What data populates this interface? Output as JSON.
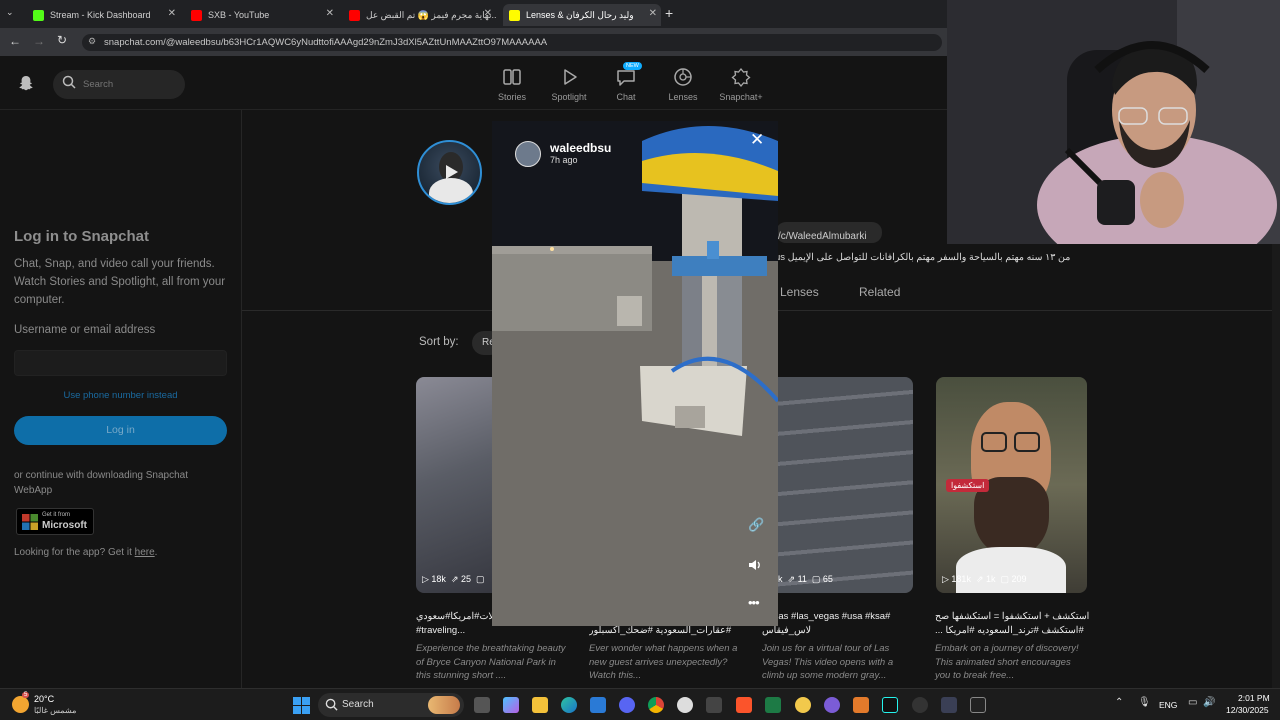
{
  "browser": {
    "tabs": [
      {
        "label": "Stream - Kick Dashboard",
        "icon": "kick-icon",
        "color": "#53fc18"
      },
      {
        "label": "SXB - YouTube",
        "icon": "youtube-icon",
        "color": "#ff0000"
      },
      {
        "label": "نهاية مجرم فيمز 😱 تم القبض عل...",
        "icon": "youtube-icon",
        "color": "#ff0000"
      },
      {
        "label": "وليد رحال الكرفان & Lenses",
        "icon": "snapchat-icon",
        "color": "#fffc00",
        "active": true
      }
    ],
    "new_tab_label": "+",
    "url": "snapchat.com/@waleedbsu/b63HCr1AQWC6yNudttofiAAAgd29nZmJ3dXl5AZttUnMAAZttO97MAAAAAA"
  },
  "snapchat": {
    "search_placeholder": "Search",
    "nav": [
      {
        "label": "Stories",
        "icon": "stories-icon"
      },
      {
        "label": "Spotlight",
        "icon": "spotlight-icon"
      },
      {
        "label": "Chat",
        "icon": "chat-icon",
        "badge": "NEW"
      },
      {
        "label": "Lenses",
        "icon": "lenses-icon"
      },
      {
        "label": "Snapchat+",
        "icon": "snapchat-plus-icon"
      }
    ],
    "login": {
      "title": "Log in to Snapchat",
      "subtitle": "Chat, Snap, and video call your friends. Watch Stories and Spotlight, all from your computer.",
      "username_label": "Username or email address",
      "username_value": "",
      "phone_link": "Use phone number instead",
      "login_button": "Log in",
      "webapp_text": "or continue with downloading Snapchat WebApp",
      "store_small": "Get it from",
      "store_big": "Microsoft",
      "app_text": "Looking for the app? Get it",
      "app_link": "here",
      "app_end": "."
    },
    "profile": {
      "link": "/c/WaleedAlmubarki",
      "bio": "من ١٣ سنه مهتم بالسياحة والسفر مهتم بالكرافانات للتواصل على الإيميل us",
      "tabs": [
        "Lenses",
        "Related"
      ]
    },
    "sort_label": "Sort by:",
    "sort_value": "Re",
    "cards": [
      {
        "views": "18k",
        "shares": "25",
        "comments": "",
        "title": "سبحان الخالق #رحلات#امريكا#سعودي #traveling...",
        "desc": "Experience the breathtaking beauty of Bryce Canyon National Park in this stunning short ...."
      },
      {
        "views": "",
        "shares": "",
        "comments": "",
        "title": "#عقارات_السعودية #ضحك_اكسبلور",
        "desc": "Ever wonder what happens when a new guest arrives unexpectedly? Watch this..."
      },
      {
        "views": "31k",
        "shares": "11",
        "comments": "65",
        "title": "Vegas #las_vegas #usa #ksa# لاس_فيقاس",
        "desc": "Join us for a virtual tour of Las Vegas! This video opens with a climb up some modern gray..."
      },
      {
        "views": "181k",
        "shares": "1k",
        "comments": "209",
        "title": "استكشف + استكشفوا = استكشفها صح #استكشف #ترند_السعوديه #امريكا ...",
        "desc": "Embark on a journey of discovery! This animated short encourages you to break free...",
        "sticker": "استكشفوا"
      }
    ],
    "viewer": {
      "username": "waleedbsu",
      "time": "7h ago"
    }
  },
  "taskbar": {
    "weather_temp": "20°C",
    "weather_desc": "مشمس غالبًا",
    "search_label": "Search",
    "lang": "ENG",
    "time": "2:01 PM",
    "date": "12/30/2025",
    "notif_badge": "5"
  }
}
